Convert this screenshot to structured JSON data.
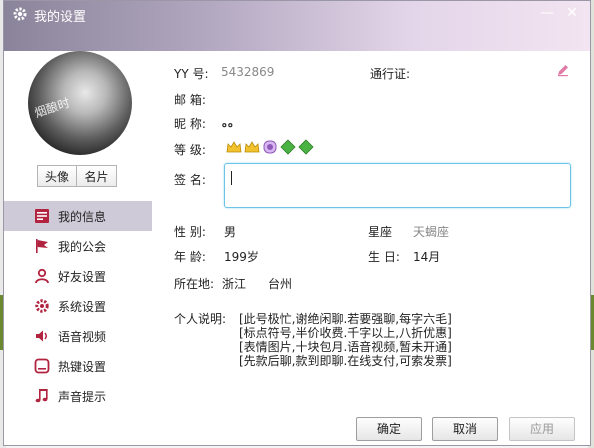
{
  "window": {
    "title": "我的设置"
  },
  "avatar": {
    "watermark": "烟酿时"
  },
  "avatar_tabs": [
    "头像",
    "名片"
  ],
  "nav": [
    {
      "label": "我的信息",
      "icon": "id-card-icon",
      "active": true
    },
    {
      "label": "我的公会",
      "icon": "flag-icon",
      "active": false
    },
    {
      "label": "好友设置",
      "icon": "user-icon",
      "active": false
    },
    {
      "label": "系统设置",
      "icon": "gear-icon",
      "active": false
    },
    {
      "label": "语音视频",
      "icon": "speaker-icon",
      "active": false
    },
    {
      "label": "热键设置",
      "icon": "keyboard-icon",
      "active": false
    },
    {
      "label": "声音提示",
      "icon": "music-note-icon",
      "active": false
    }
  ],
  "profile": {
    "yy_label": "YY  号:",
    "yy_value": "5432869",
    "pass_label": "通行证:",
    "email_label": "邮  箱:",
    "nick_label": "昵  称:",
    "nick_value": "。。",
    "level_label": "等  级:",
    "sig_label": "签  名:",
    "gender_label": "性  别:",
    "gender_value": "男",
    "zodiac_label": "星座",
    "zodiac_value": "天蝎座",
    "age_label": "年  龄:",
    "age_value": "199岁",
    "birthday_label": "生  日:",
    "birthday_value": "14月",
    "location_label": "所在地:",
    "province": "浙江",
    "city": "台州",
    "desc_label": "个人说明:",
    "desc_lines": [
      "[此号极忙,谢绝闲聊.若要强聊,每字六毛]",
      "[标点符号,半价收费.千字以上,八折优惠]",
      "[表情图片,十块包月.语音视频,暂未开通]",
      "[先款后聊,款到即聊.在线支付,可索发票]"
    ]
  },
  "buttons": {
    "ok": "确定",
    "cancel": "取消",
    "apply": "应用"
  },
  "colors": {
    "active_nav": "#cfcad7",
    "input_focus": "#6cc5e9",
    "title_gradient_end": "#f2e4f0"
  }
}
